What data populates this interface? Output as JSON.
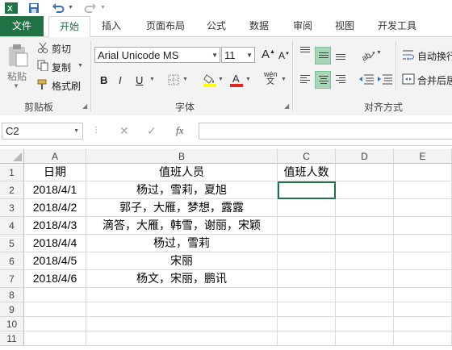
{
  "ribbon_tabs": [
    "文件",
    "开始",
    "插入",
    "页面布局",
    "公式",
    "数据",
    "审阅",
    "视图",
    "开发工具"
  ],
  "clipboard": {
    "paste": "粘贴",
    "cut": "剪切",
    "copy": "复制",
    "format_painter": "格式刷",
    "group": "剪贴板"
  },
  "font": {
    "name": "Arial Unicode MS",
    "size": "11",
    "bold": "B",
    "italic": "I",
    "underline": "U",
    "grow": "A",
    "shrink": "A",
    "phonetic": "wén",
    "group": "字体"
  },
  "alignment": {
    "wrap_text": "自动换行",
    "merge_center": "合并后居",
    "group": "对齐方式"
  },
  "formula_bar": {
    "name_box": "C2",
    "fx": "fx",
    "value": ""
  },
  "colors": {
    "excel_green": "#217346",
    "fill_yellow": "#ffff00",
    "font_red": "#e0281f",
    "selected_btn": "#a9d6b9"
  },
  "sheet": {
    "columns": [
      "A",
      "B",
      "C",
      "D",
      "E"
    ],
    "rows": [
      "1",
      "2",
      "3",
      "4",
      "5",
      "6",
      "7",
      "8",
      "9",
      "10",
      "11"
    ],
    "cells": [
      [
        "日期",
        "值班人员",
        "值班人数"
      ],
      [
        "2018/4/1",
        "杨过，雪莉，夏旭",
        ""
      ],
      [
        "2018/4/2",
        "郭子，大雁，梦想，露露",
        ""
      ],
      [
        "2018/4/3",
        "滴答，大雁，韩雪，谢丽，宋颖",
        ""
      ],
      [
        "2018/4/4",
        "杨过，雪莉",
        ""
      ],
      [
        "2018/4/5",
        "宋丽",
        ""
      ],
      [
        "2018/4/6",
        "杨文，宋丽，鹏讯",
        ""
      ]
    ]
  }
}
